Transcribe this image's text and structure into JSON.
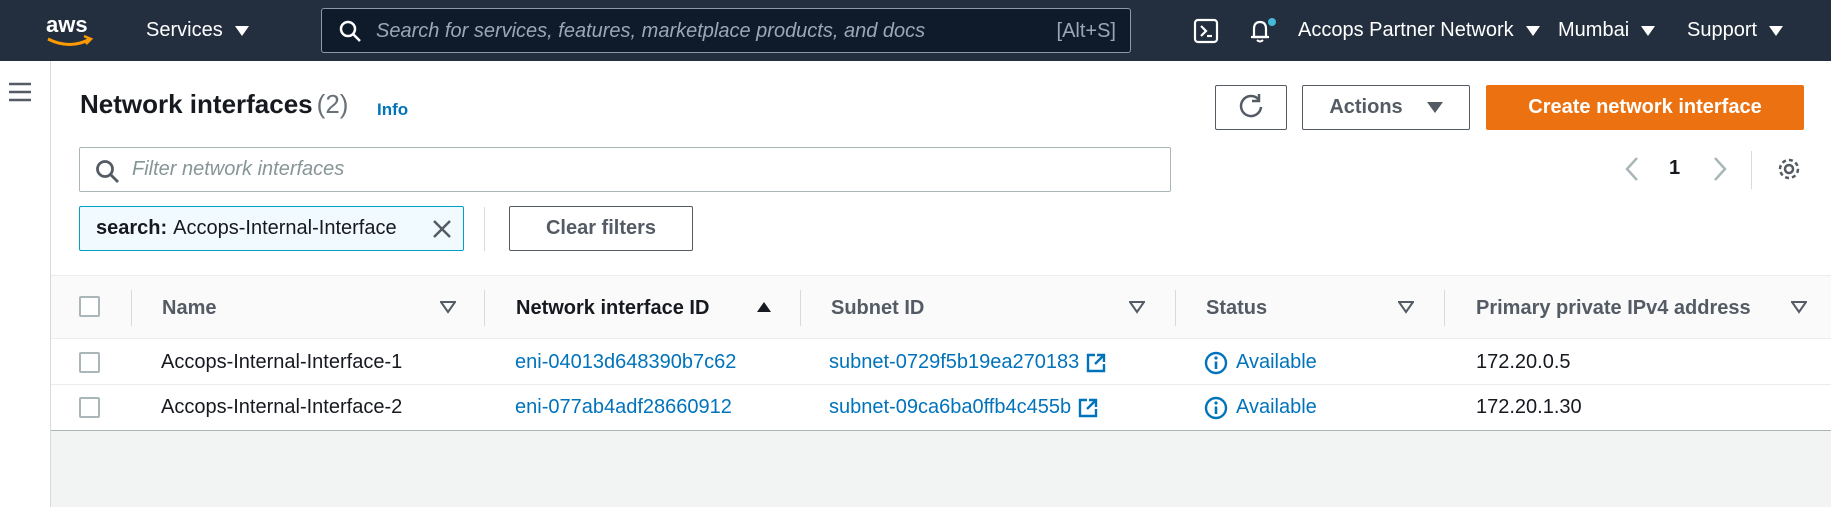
{
  "topnav": {
    "logo_text": "aws",
    "services_label": "Services",
    "search_placeholder": "Search for services, features, marketplace products, and docs",
    "search_shortcut": "[Alt+S]",
    "account_label": "Accops Partner Network",
    "region_label": "Mumbai",
    "support_label": "Support"
  },
  "page": {
    "title": "Network interfaces",
    "count": "(2)",
    "info_link": "Info",
    "actions_label": "Actions",
    "create_label": "Create network interface",
    "filter_placeholder": "Filter network interfaces",
    "page_number": "1",
    "token_key": "search:",
    "token_value": "Accops-Internal-Interface",
    "clear_filters_label": "Clear filters"
  },
  "table": {
    "columns": {
      "name": "Name",
      "eni": "Network interface ID",
      "subnet": "Subnet ID",
      "status": "Status",
      "ipv4": "Primary private IPv4 address"
    },
    "rows": [
      {
        "name": "Accops-Internal-Interface-1",
        "eni": "eni-04013d648390b7c62",
        "subnet": "subnet-0729f5b19ea270183",
        "status": "Available",
        "ipv4": "172.20.0.5"
      },
      {
        "name": "Accops-Internal-Interface-2",
        "eni": "eni-077ab4adf28660912",
        "subnet": "subnet-09ca6ba0ffb4c455b",
        "status": "Available",
        "ipv4": "172.20.1.30"
      }
    ]
  },
  "colors": {
    "nav_bg": "#232f3e",
    "primary_orange": "#ec7211",
    "link_blue": "#0073bb",
    "token_border": "#00a1c9"
  },
  "icons": [
    "aws-logo",
    "search-icon",
    "cloudshell-icon",
    "bell-icon",
    "hamburger-icon",
    "refresh-icon",
    "chevron-left-icon",
    "chevron-right-icon",
    "gear-icon",
    "close-icon",
    "sort-icon",
    "external-link-icon",
    "info-status-icon"
  ]
}
